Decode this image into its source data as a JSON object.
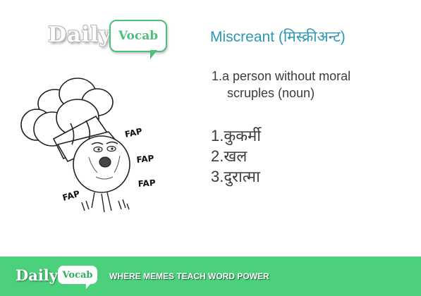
{
  "logo": {
    "daily": "Daily",
    "vocab": "Vocab"
  },
  "word": {
    "title": "Miscreant (मिस्क्रीअन्ट)"
  },
  "definition": {
    "line1": "1.a person without moral",
    "line2": "scruples (noun)"
  },
  "meanings": [
    "1.कुकर्मी",
    "2.खल",
    "3.दुरात्मा"
  ],
  "meme": {
    "sound_effects": [
      "FAP",
      "FAP",
      "FAP",
      "FAP"
    ]
  },
  "footer": {
    "daily": "Daily",
    "vocab": "Vocab",
    "tagline": "WHERE MEMES TEACH WORD POWER"
  },
  "colors": {
    "brand_green": "#4bd07c",
    "title_blue": "#2e97b2",
    "text": "#3c3c3c"
  }
}
